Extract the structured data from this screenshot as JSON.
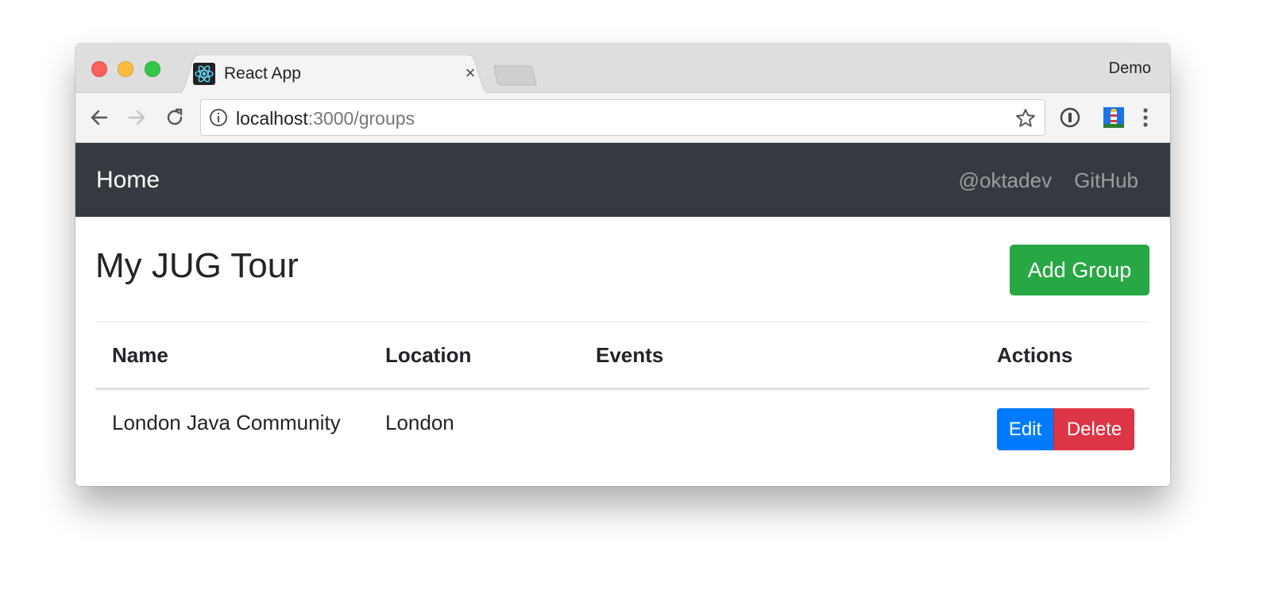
{
  "browser": {
    "tab": {
      "title": "React App",
      "close_glyph": "×",
      "favicon": "react-logo-icon"
    },
    "profile_name": "Demo",
    "address": {
      "host": "localhost",
      "path": ":3000/groups"
    },
    "icons": {
      "back": "back-arrow-icon",
      "forward": "forward-arrow-icon",
      "reload": "reload-icon",
      "info": "info-icon",
      "bookmark": "star-icon",
      "password_manager": "1password-icon",
      "extension": "lighthouse-icon",
      "menu": "kebab-menu-icon"
    }
  },
  "navbar": {
    "brand": "Home",
    "links": [
      "@oktadev",
      "GitHub"
    ],
    "bg_color": "#343a40"
  },
  "page": {
    "title": "My JUG Tour",
    "add_button": "Add Group",
    "add_button_color": "#28a745"
  },
  "table": {
    "headers": [
      "Name",
      "Location",
      "Events",
      "Actions"
    ],
    "rows": [
      {
        "name": "London Java Community",
        "location": "London",
        "events": "",
        "actions": {
          "edit": "Edit",
          "delete": "Delete"
        }
      }
    ],
    "edit_color": "#007bff",
    "delete_color": "#dc3545"
  }
}
